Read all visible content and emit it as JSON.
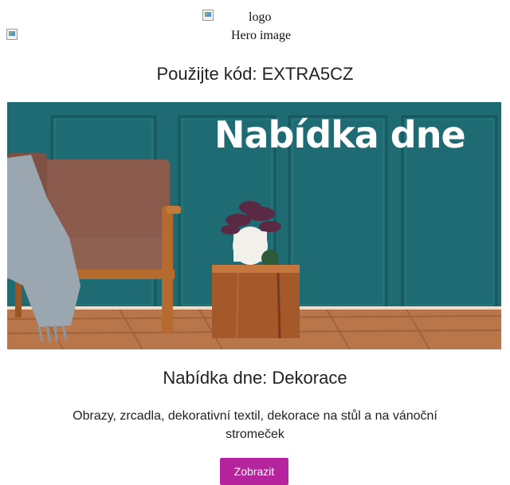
{
  "header": {
    "logo_alt": "logo",
    "hero_alt": "Hero image"
  },
  "promo": {
    "code_text": "Použijte kód: EXTRA5CZ"
  },
  "banner": {
    "title": "Nabídka dne"
  },
  "offer": {
    "title": "Nabídka dne: Dekorace",
    "description": "Obrazy, zrcadla, dekorativní textil, dekorace na stůl a na vánoční stromeček",
    "button_label": "Zobrazit"
  },
  "colors": {
    "button_bg": "#b5239d",
    "banner_wall": "#1f6b73"
  }
}
